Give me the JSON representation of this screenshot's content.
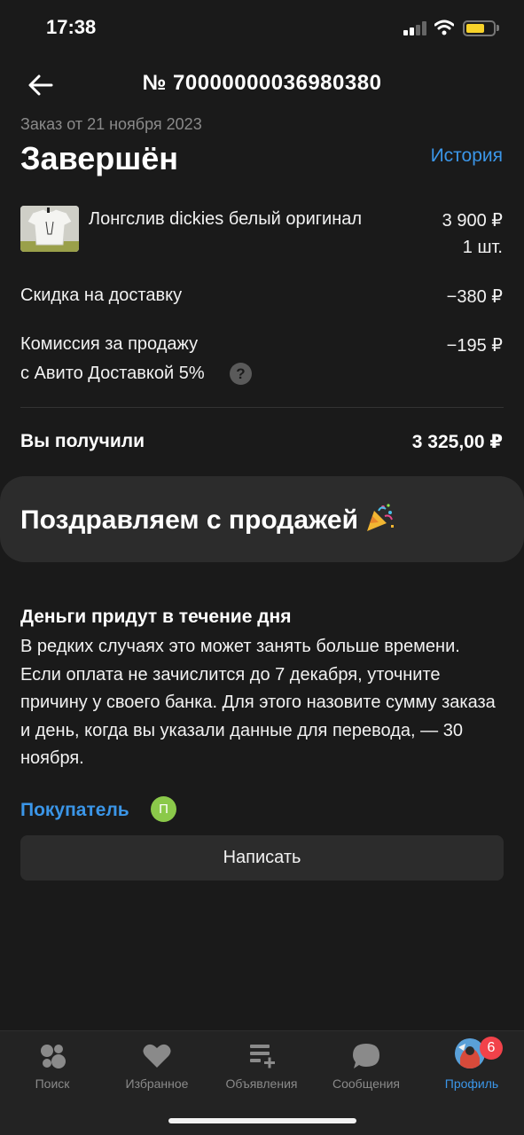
{
  "status_bar": {
    "time": "17:38"
  },
  "header": {
    "order_number": "№ 70000000036980380"
  },
  "order": {
    "date": "Заказ от 21 ноября 2023",
    "status": "Завершён",
    "history_label": "История"
  },
  "product": {
    "title": "Лонгслив dickies белый оригинал",
    "price": "3 900 ₽",
    "quantity": "1 шт."
  },
  "lines": [
    {
      "label": "Скидка на доставку",
      "value": "−380 ₽"
    },
    {
      "label_line1": "Комиссия за продажу",
      "label_line2": "с Авито Доставкой 5%",
      "value": "−195 ₽",
      "help_icon": "?"
    }
  ],
  "total": {
    "label": "Вы получили",
    "value": "3 325,00 ₽"
  },
  "congrats": {
    "text": "Поздравляем с продажей",
    "icon": "party-popper-icon"
  },
  "money_info": {
    "title": "Деньги придут в течение дня",
    "text": "В редких случаях это может занять больше времени. Если оплата не зачислится до 7 декабря, уточните причину у своего банка. Для этого назовите сумму заказа и день, когда вы указали данные для перевода, — 30 ноября."
  },
  "buyer": {
    "label": "Покупатель",
    "avatar_letter": "П",
    "write_button": "Написать"
  },
  "tabbar": {
    "tabs": [
      {
        "label": "Поиск",
        "icon": "search-dots-icon"
      },
      {
        "label": "Избранное",
        "icon": "heart-icon"
      },
      {
        "label": "Объявления",
        "icon": "listings-icon"
      },
      {
        "label": "Сообщения",
        "icon": "chat-bubble-icon"
      },
      {
        "label": "Профиль",
        "icon": "profile-avatar",
        "badge": "6",
        "active": true
      }
    ]
  },
  "colors": {
    "accent": "#3b96e8",
    "background": "#1a1a1a",
    "card": "#2c2c2c",
    "badge": "#f2424a",
    "avatar": "#8bc94a"
  }
}
